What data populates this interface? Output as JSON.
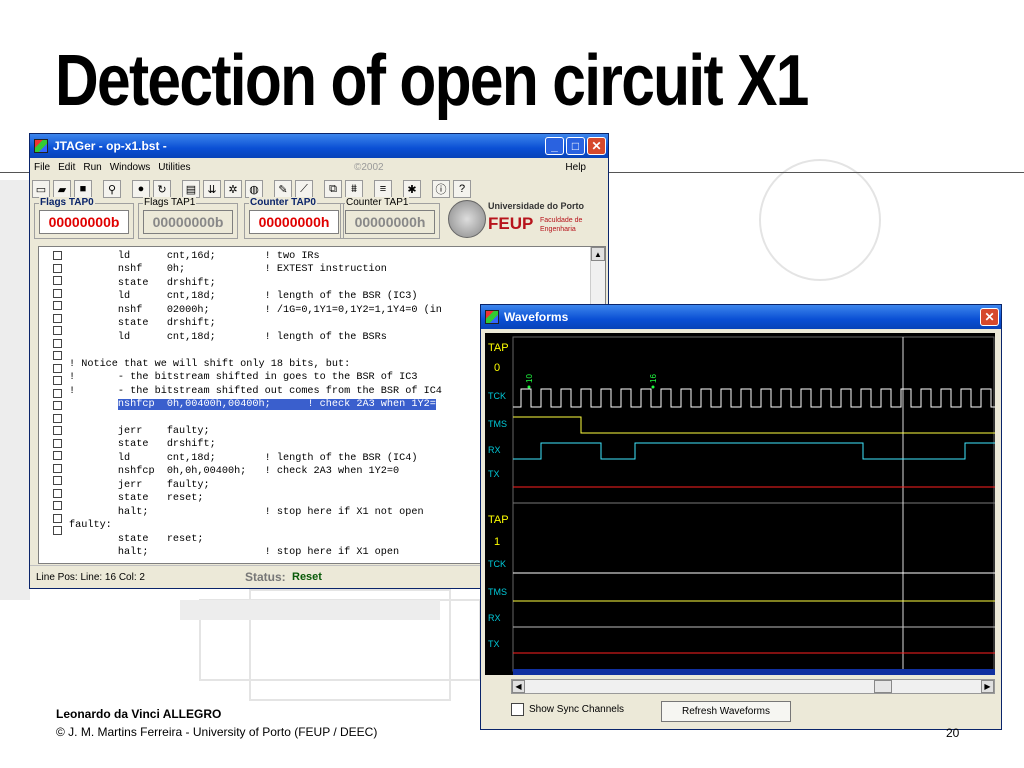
{
  "slide": {
    "title": "Detection of open circuit X1",
    "footer_line1": "Leonardo da Vinci ALLEGRO",
    "footer_line2": "© J. M. Martins Ferreira - University of Porto (FEUP / DEEC)",
    "page_number": "20"
  },
  "jtager": {
    "title": "JTAGer - op-x1.bst -",
    "menu": [
      "File",
      "Edit",
      "Run",
      "Windows",
      "Utilities"
    ],
    "menu_copyright": "©2002",
    "menu_help": "Help",
    "registers": [
      {
        "label": "Flags TAP0",
        "value": "00000000b",
        "active": true
      },
      {
        "label": "Flags TAP1",
        "value": "00000000b",
        "active": false
      },
      {
        "label": "Counter TAP0",
        "value": "00000000h",
        "active": true
      },
      {
        "label": "Counter TAP1",
        "value": "00000000h",
        "active": false
      }
    ],
    "logo": {
      "university": "Universidade do Porto",
      "school": "FEUP",
      "faculty_line1": "Faculdade de",
      "faculty_line2": "Engenharia"
    },
    "code_lines": [
      "        ld      cnt,16d;        ! two IRs",
      "        nshf    0h;             ! EXTEST instruction",
      "        state   drshift;",
      "        ld      cnt,18d;        ! length of the BSR (IC3)",
      "        nshf    02000h;         ! /1G=0,1Y1=0,1Y2=1,1Y4=0 (in",
      "        state   drshift;",
      "        ld      cnt,18d;        ! length of the BSRs",
      "",
      "! Notice that we will shift only 18 bits, but:",
      "!       - the bitstream shifted in goes to the BSR of IC3",
      "!       - the bitstream shifted out comes from the BSR of IC4",
      "        nshfcp  0h,00400h,00400h;      ! check 2A3 when 1Y2=",
      "",
      "        jerr    faulty;",
      "        state   drshift;",
      "        ld      cnt,18d;        ! length of the BSR (IC4)",
      "        nshfcp  0h,0h,00400h;   ! check 2A3 when 1Y2=0",
      "        jerr    faulty;",
      "        state   reset;",
      "        halt;                   ! stop here if X1 not open",
      "faulty:",
      "        state   reset;",
      "        halt;                   ! stop here if X1 open"
    ],
    "highlighted_line_index": 11,
    "status_left": "Line Pos: Line: 16  Col: 2",
    "status_label": "Status:",
    "status_value": "Reset"
  },
  "waveforms": {
    "title": "Waveforms",
    "tap0_label": "TAP",
    "tap0_num": "0",
    "tap1_label": "TAP",
    "tap1_num": "1",
    "signals": [
      "TCK",
      "TMS",
      "RX",
      "TX"
    ],
    "markers": [
      "10",
      "16"
    ],
    "show_sync_label": "Show Sync Channels",
    "refresh_label": "Refresh Waveforms",
    "colors": {
      "tck": "#ffffff",
      "tms": "#ffff40",
      "rx": "#40e8ff",
      "tx": "#ff2020",
      "label": "#00c8d8",
      "tap": "#ffff00",
      "marker": "#20ff40"
    }
  }
}
